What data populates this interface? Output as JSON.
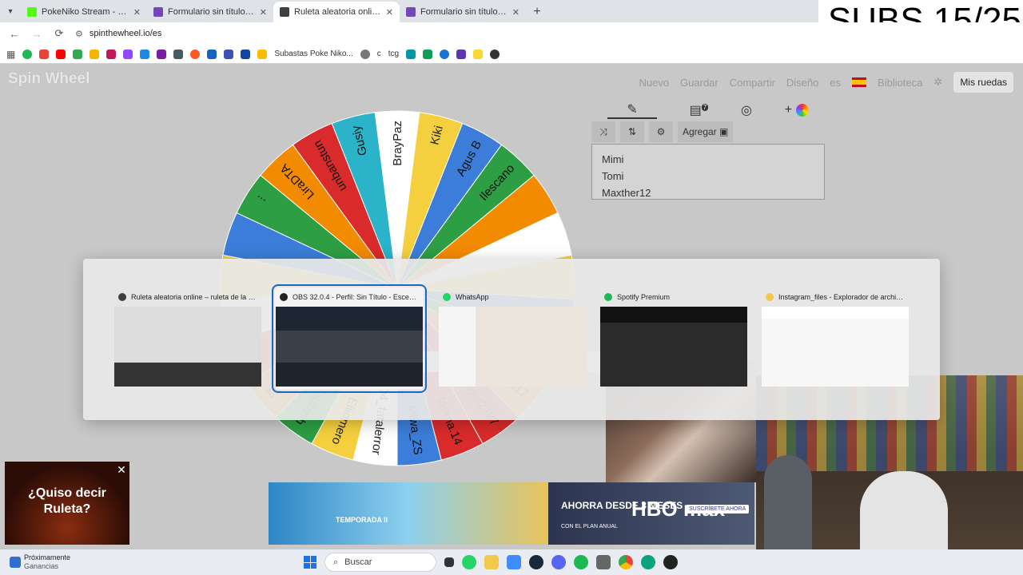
{
  "browser": {
    "tabs": [
      {
        "title": "PokeNiko Stream - Watch Live",
        "color": "#53fc18",
        "active": false
      },
      {
        "title": "Formulario sin título - Formulario",
        "color": "#7248b9",
        "active": false
      },
      {
        "title": "Ruleta aleatoria online - ruleta",
        "color": "#3c4043",
        "active": true
      },
      {
        "title": "Formulario sin título - Formulario",
        "color": "#7248b9",
        "active": false
      }
    ],
    "url": "spinthewheel.io/es",
    "bookmark_label": "Subastas Poke Niko...",
    "bookmark_label2": "c",
    "bookmark_label3": "tcg"
  },
  "overlay_text": "SUBS 15/25",
  "site": {
    "logo": "Spin Wheel",
    "nav": [
      "Nuevo",
      "Guardar",
      "Compartir",
      "Diseño",
      "es",
      "Biblioteca"
    ],
    "my_wheels": "Mis ruedas",
    "add_label": "Agregar",
    "badge": "7",
    "names": [
      "Mimi",
      "Tomi",
      "Maxther12"
    ]
  },
  "wheel": {
    "segments": [
      {
        "label": "BrayPaz",
        "color": "#ffffff"
      },
      {
        "label": "Kiki",
        "color": "#f4d03f"
      },
      {
        "label": "Agus B",
        "color": "#3b7dd8"
      },
      {
        "label": "Ilescano",
        "color": "#2e9e44"
      },
      {
        "label": "",
        "color": "#f28b00"
      },
      {
        "label": "",
        "color": "#ffffff"
      },
      {
        "label": "",
        "color": "#f4d03f"
      },
      {
        "label": "",
        "color": "#3b7dd8"
      },
      {
        "label": "tin_F5",
        "color": "#2e9e44"
      },
      {
        "label": "carlosber117",
        "color": "#f28b00"
      },
      {
        "label": "mikita2387",
        "color": "#d92b2b"
      },
      {
        "label": "lanma.14",
        "color": "#d92b2b"
      },
      {
        "label": "Miwa_ZS",
        "color": "#3b7dd8"
      },
      {
        "label": "404_fatalerror",
        "color": "#ffffff"
      },
      {
        "label": "Eliiomero",
        "color": "#f4d03f"
      },
      {
        "label": "Maukush",
        "color": "#2e9e44"
      },
      {
        "label": "Maxther12",
        "color": "#f28b00"
      },
      {
        "label": "",
        "color": "#d92b2b"
      },
      {
        "label": "",
        "color": "#ffffff"
      },
      {
        "label": "",
        "color": "#f4d03f"
      },
      {
        "label": "",
        "color": "#3b7dd8"
      },
      {
        "label": "...",
        "color": "#2e9e44"
      },
      {
        "label": "LiraDTA",
        "color": "#f28b00"
      },
      {
        "label": "unbanstun",
        "color": "#d92b2b"
      },
      {
        "label": "Gusiy",
        "color": "#2bb3c9"
      }
    ]
  },
  "switcher": {
    "windows": [
      {
        "title": "Ruleta aleatoria online – ruleta de la suer...",
        "icon_color": "#3c4043",
        "selected": false
      },
      {
        "title": "OBS 32.0.4 - Perfil: Sin Título - Escenas: Si...",
        "icon_color": "#222222",
        "selected": true
      },
      {
        "title": "WhatsApp",
        "icon_color": "#25d366",
        "selected": false
      },
      {
        "title": "Spotify Premium",
        "icon_color": "#1db954",
        "selected": false
      },
      {
        "title": "Instagram_files - Explorador de archivos",
        "icon_color": "#f2c94c",
        "selected": false
      }
    ]
  },
  "ads": {
    "left": "¿Quiso decir Ruleta?",
    "gumball": "TEMPORADA II",
    "hbo_promo": "AHORRA DESDE 3 MESES",
    "hbo_sub": "CON EL PLAN ANUAL",
    "hbo_logo": "HBO max",
    "hbo_cta": "SUSCRÍBETE AHORA"
  },
  "taskbar": {
    "weather_title": "Próximamente",
    "weather_sub": "Ganancias",
    "search_placeholder": "Buscar",
    "badge_count": "34"
  }
}
